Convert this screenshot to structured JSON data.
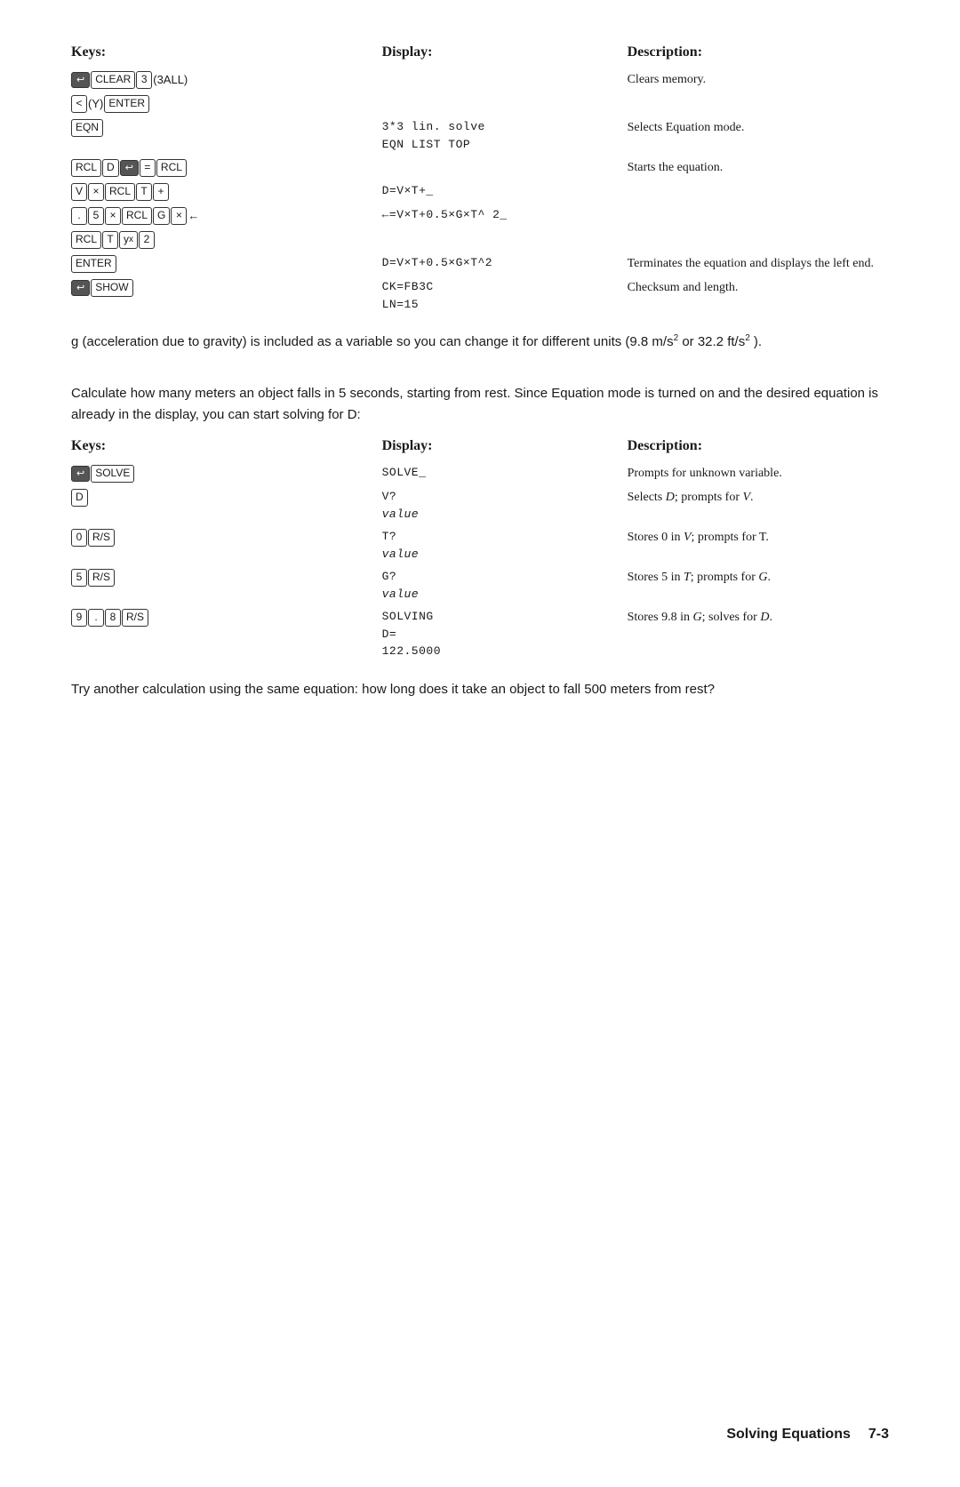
{
  "page": {
    "title": "Solving Equations",
    "page_number": "7-3"
  },
  "table1": {
    "col1": "Keys:",
    "col2": "Display:",
    "col3": "Description:",
    "rows": [
      {
        "keys_html": "shift_clear_3_3all",
        "display": "",
        "description": "Clears memory."
      },
      {
        "keys_html": "lt_y_enter",
        "display": "",
        "description": ""
      },
      {
        "keys_html": "eqn",
        "display": "3*3 lin. solve\nEQN LIST TOP",
        "description": "Selects Equation mode."
      },
      {
        "keys_html": "rcl_d_shift_eq_rcl",
        "display": "",
        "description": "Starts the equation."
      },
      {
        "keys_html": "v_x_rcl_t_plus",
        "display": "D=V×T+_",
        "description": ""
      },
      {
        "keys_html": "dot_5_x_rcl_g_x_arrow",
        "display": "←=V×T+0.5×G×T^ 2_",
        "description": ""
      },
      {
        "keys_html": "rcl_t_yx_2",
        "display": "",
        "description": ""
      },
      {
        "keys_html": "enter",
        "display": "D=V×T+0.5×G×T^2",
        "description": "Terminates the equation and displays the left end."
      },
      {
        "keys_html": "shift_show",
        "display": "CK=FB3C\nLN=15",
        "description": "Checksum and length."
      }
    ]
  },
  "para1": "g (acceleration due to gravity) is included as a variable so you can change it for different units (9.8 m/s",
  "para1b": " or 32.2 ft/s",
  "para1c": " ).",
  "para2": "Calculate how many meters an object falls in 5 seconds, starting from rest. Since Equation mode is turned on and the desired equation is already in the display, you can start solving for D:",
  "table2": {
    "col1": "Keys:",
    "col2": "Display:",
    "col3": "Description:",
    "rows": [
      {
        "keys": "shift_solve",
        "display": "SOLVE_",
        "description": "Prompts for unknown variable."
      },
      {
        "keys": "d",
        "display": "V?\nvalue",
        "description": "Selects D; prompts for V."
      },
      {
        "keys": "0_rs",
        "display": "T?\nvalue",
        "description": "Stores 0 in V; prompts for T."
      },
      {
        "keys": "5_rs",
        "display": "G?\nvalue",
        "description": "Stores 5 in T; prompts for G."
      },
      {
        "keys": "9_dot_8_rs",
        "display": "SOLVING\nD=\n122.5000",
        "description": "Stores 9.8 in G; solves for D."
      }
    ]
  },
  "para3": "Try another calculation using the same equation: how long does it take an object to fall 500 meters from rest?"
}
